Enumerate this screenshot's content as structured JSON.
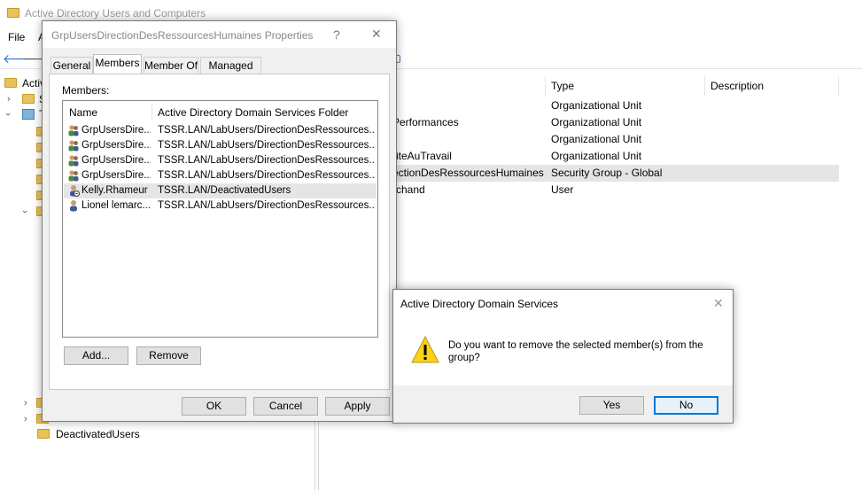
{
  "window": {
    "title": "Active Directory Users and Computers"
  },
  "menu": {
    "file": "File",
    "action_partial": "A"
  },
  "tree": {
    "root_partial": "Active",
    "item_s_partial": "S",
    "item_t_partial": "T",
    "deactivated": "DeactivatedUsers"
  },
  "list": {
    "headers": {
      "type": "Type",
      "description": "Description"
    },
    "rows": [
      {
        "name": "",
        "type": "Organizational Unit"
      },
      {
        "name": "Performances",
        "type": "Organizational Unit"
      },
      {
        "name": "t",
        "type": "Organizational Unit"
      },
      {
        "name": "riteAuTravail",
        "type": "Organizational Unit"
      },
      {
        "name": "ectionDesRessourcesHumaines",
        "type": "Security Group - Global"
      },
      {
        "name": "rchand",
        "type": "User"
      }
    ]
  },
  "properties": {
    "title": "GrpUsersDirectionDesRessourcesHumaines Properties",
    "help": "?",
    "close": "✕",
    "tabs": {
      "general": "General",
      "members": "Members",
      "member_of": "Member Of",
      "managed_by": "Managed By"
    },
    "members_label": "Members:",
    "columns": {
      "name": "Name",
      "folder": "Active Directory Domain Services Folder"
    },
    "members": [
      {
        "name": "GrpUsersDire...",
        "folder": "TSSR.LAN/LabUsers/DirectionDesRessources..."
      },
      {
        "name": "GrpUsersDire...",
        "folder": "TSSR.LAN/LabUsers/DirectionDesRessources..."
      },
      {
        "name": "GrpUsersDire...",
        "folder": "TSSR.LAN/LabUsers/DirectionDesRessources..."
      },
      {
        "name": "GrpUsersDire...",
        "folder": "TSSR.LAN/LabUsers/DirectionDesRessources..."
      },
      {
        "name": "Kelly.Rhameur",
        "folder": "TSSR.LAN/DeactivatedUsers"
      },
      {
        "name": "Lionel lemarc...",
        "folder": "TSSR.LAN/LabUsers/DirectionDesRessources..."
      }
    ],
    "buttons": {
      "add": "Add...",
      "remove": "Remove",
      "ok": "OK",
      "cancel": "Cancel",
      "apply": "Apply"
    }
  },
  "confirm": {
    "title": "Active Directory Domain Services",
    "close": "✕",
    "message_line1": "Do you want to remove the selected member(s) from the",
    "message_line2": "group?",
    "yes": "Yes",
    "no": "No"
  },
  "colors": {
    "accent": "#0078d7",
    "warning": "#fcd116",
    "selected_row": "#e5e5e5"
  }
}
